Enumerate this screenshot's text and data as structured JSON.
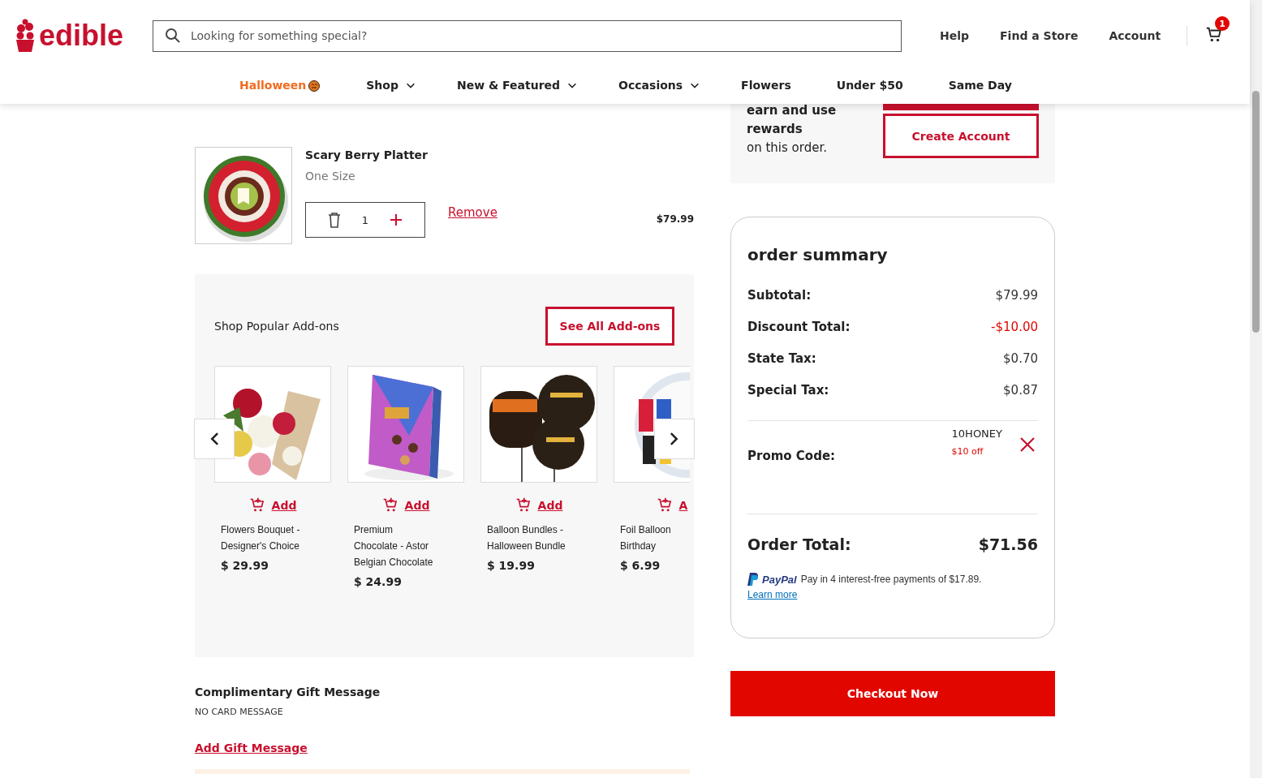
{
  "header": {
    "logo": "edible",
    "search": {
      "placeholder": "Looking for something special?"
    },
    "links": [
      "Help",
      "Find a Store",
      "Account"
    ],
    "cart_count": "1"
  },
  "nav": [
    {
      "label": "Halloween",
      "kind": "seasonal"
    },
    {
      "label": "Shop",
      "kind": "dropdown"
    },
    {
      "label": "New & Featured",
      "kind": "dropdown"
    },
    {
      "label": "Occasions",
      "kind": "dropdown"
    },
    {
      "label": "Flowers",
      "kind": "plain"
    },
    {
      "label": "Under $50",
      "kind": "plain"
    },
    {
      "label": "Same Day",
      "kind": "plain"
    }
  ],
  "cart_item": {
    "name": "Scary Berry Platter",
    "size": "One Size",
    "quantity": "1",
    "remove": "Remove",
    "price": "$79.99"
  },
  "addons": {
    "title": "Shop Popular Add-ons",
    "see_all": "See All Add-ons",
    "items": [
      {
        "add": "Add",
        "name": "Flowers Bouquet - Designer's Choice",
        "price": "$ 29.99"
      },
      {
        "add": "Add",
        "name": "Premium Chocolate - Astor Belgian Chocolate",
        "price": "$ 24.99"
      },
      {
        "add": "Add",
        "name": "Balloon Bundles - Halloween Bundle",
        "price": "$ 19.99"
      },
      {
        "add": "A",
        "name": "Foil Balloon Birthday",
        "price": "$ 6.99"
      }
    ]
  },
  "gift_message": {
    "title": "Complimentary Gift Message",
    "value": "NO CARD MESSAGE",
    "link": "Add Gift Message"
  },
  "rewards": {
    "lines": [
      "earn and use",
      "rewards"
    ],
    "note": "on this order.",
    "button": "Create Account"
  },
  "order_summary": {
    "title": "order summary",
    "lines": [
      {
        "label": "Subtotal:",
        "value": "$79.99",
        "kind": "normal"
      },
      {
        "label": "Discount Total:",
        "value": "-$10.00",
        "kind": "discount"
      },
      {
        "label": "State Tax:",
        "value": "$0.70",
        "kind": "normal"
      },
      {
        "label": "Special Tax:",
        "value": "$0.87",
        "kind": "normal"
      }
    ],
    "promo": {
      "label": "Promo Code:",
      "code": "10HONEY",
      "note": "$10 off"
    },
    "total": {
      "label": "Order Total:",
      "value": "$71.56"
    },
    "paypal": {
      "brand": "PayPal",
      "text": "Pay in 4 interest-free payments of $17.89.",
      "link": "Learn more"
    }
  },
  "checkout": "Checkout Now"
}
